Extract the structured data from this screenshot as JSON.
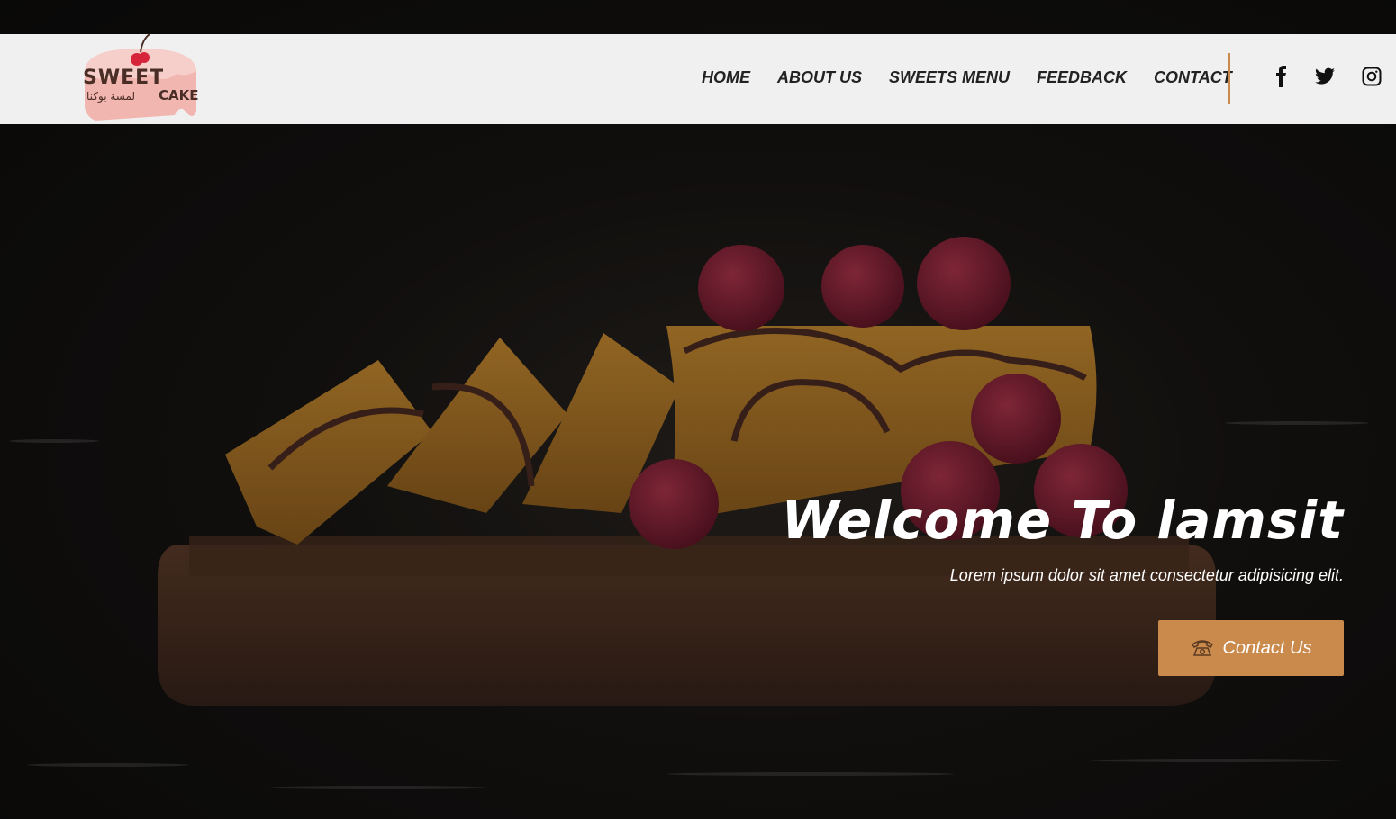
{
  "brand": {
    "word_1": "SWEET",
    "word_2": "CAKE",
    "arabic": "لمسة بوكنا"
  },
  "nav": {
    "items": [
      {
        "label": "HOME"
      },
      {
        "label": "ABOUT US"
      },
      {
        "label": "SWEETS MENU"
      },
      {
        "label": "FEEDBACK"
      },
      {
        "label": "CONTACT"
      }
    ]
  },
  "social": [
    "facebook-icon",
    "twitter-icon",
    "instagram-icon"
  ],
  "hero": {
    "title": "Welcome To lamsit",
    "subtitle": "Lorem ipsum dolor sit amet consectetur adipisicing elit.",
    "cta_label": "Contact Us",
    "cta_icon": "telephone-icon"
  },
  "colors": {
    "accent": "#c98a4c",
    "navbar": "#f0f0f0",
    "nav_text": "#222222",
    "logo_pink": "#f2b6b0",
    "logo_brown": "#4a2e25"
  }
}
